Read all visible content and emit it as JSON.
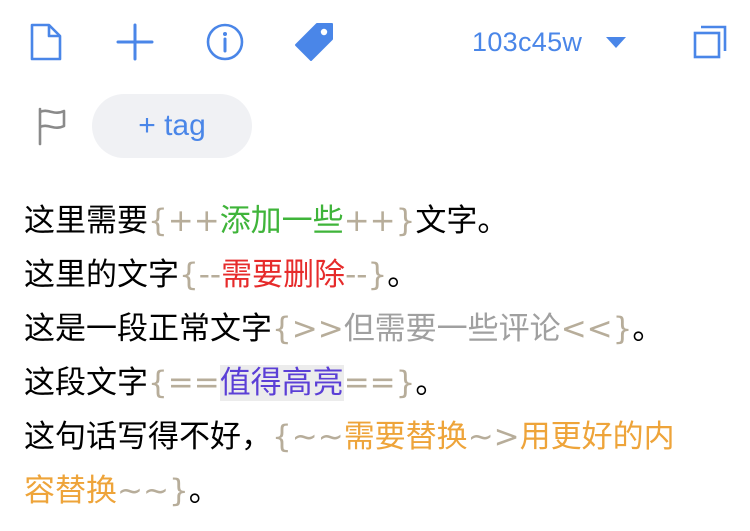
{
  "toolbar": {
    "icons": [
      "file-icon",
      "plus-icon",
      "info-icon",
      "tag-icon",
      "duplicate-icon"
    ],
    "version": "103c45w",
    "accent": "#4a86e8"
  },
  "tags": {
    "add_label": "+ tag"
  },
  "colors": {
    "markup": "#b7ad9a",
    "addition": "#3fb43a",
    "deletion": "#e62b2b",
    "comment": "#a0a0a0",
    "highlight": "#5b3fd6",
    "substitution": "#eea43a"
  },
  "content": {
    "line1": {
      "pre": "这里需要",
      "open": "{++",
      "text": "添加一些",
      "close": "++}",
      "post": "文字。"
    },
    "line2": {
      "pre": "这里的文字",
      "open": "{--",
      "text": "需要删除",
      "close": "--}",
      "post": "。"
    },
    "line3": {
      "pre": "这是一段正常文字",
      "open": "{>>",
      "text": "但需要一些评论",
      "close": "<<}",
      "post": "。"
    },
    "line4": {
      "pre": "这段文字",
      "open": "{==",
      "text": "值得高亮",
      "close": "==}",
      "post": "。"
    },
    "line5": {
      "pre": "这句话写得不好，",
      "open": "{~~",
      "old": "需要替换",
      "arrow": "~>",
      "new_part1": "用更好的内"
    },
    "line6": {
      "new_part2": "容替换",
      "close": "~~}",
      "post": "。"
    }
  }
}
